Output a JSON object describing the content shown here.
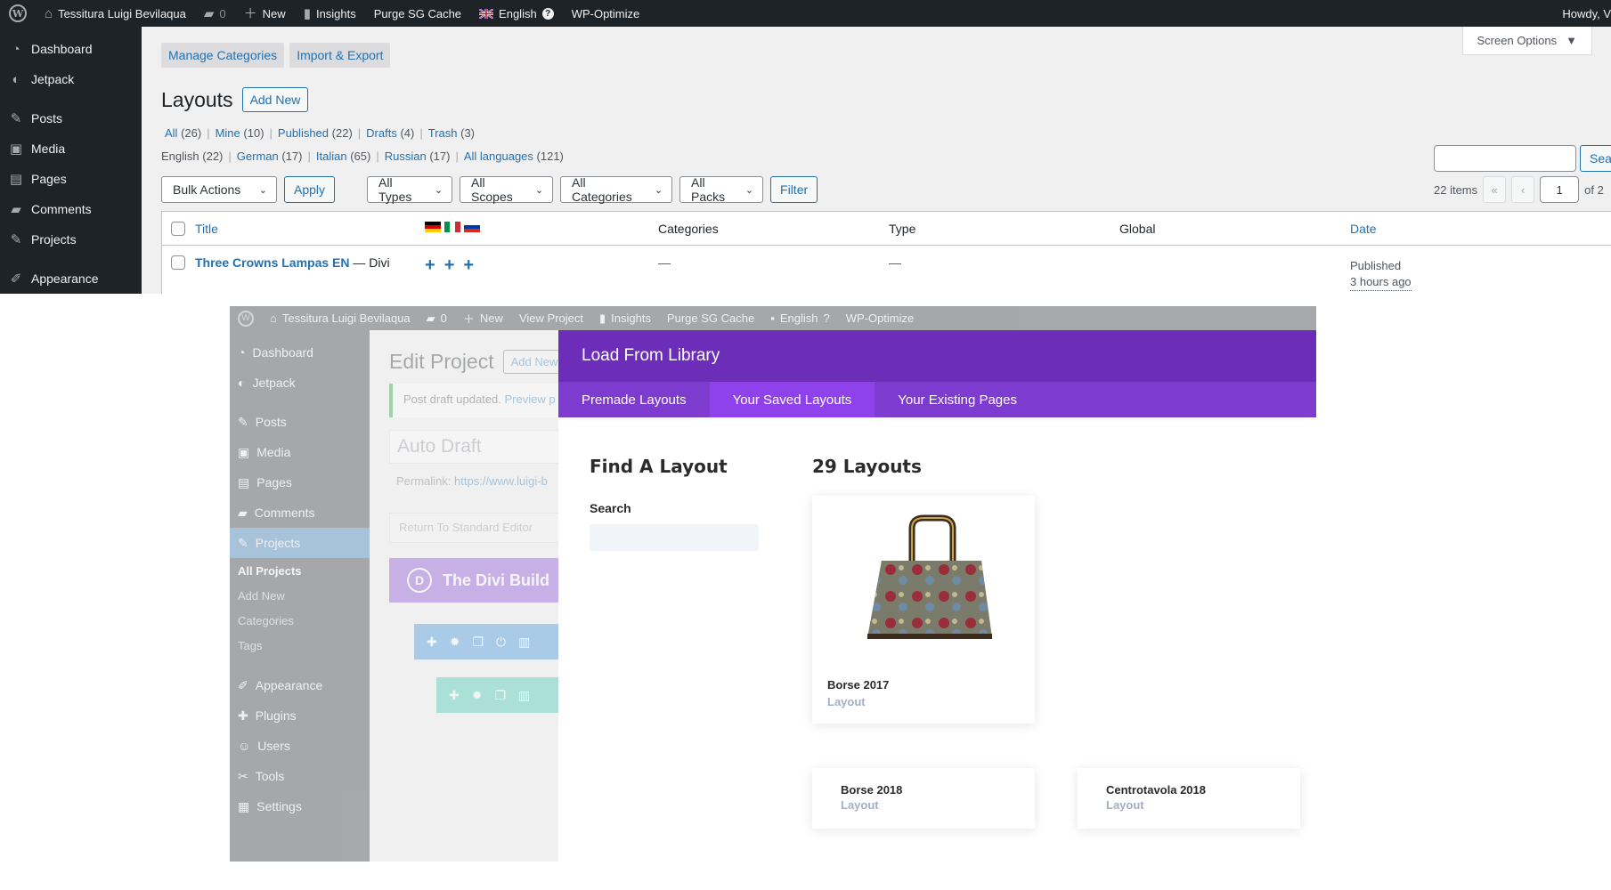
{
  "top": {
    "adminbar": {
      "site_name": "Tessitura Luigi Bevilaqua",
      "comments_count": "0",
      "new_label": "New",
      "insights_label": "Insights",
      "purge_label": "Purge SG Cache",
      "language_label": "English",
      "optimize_label": "WP-Optimize",
      "howdy_label": "Howdy, V"
    },
    "sidebar": [
      "Dashboard",
      "Jetpack",
      "Posts",
      "Media",
      "Pages",
      "Comments",
      "Projects",
      "Appearance"
    ],
    "subtabs": [
      "Manage Categories",
      "Import & Export"
    ],
    "screen_options": "Screen Options",
    "page_title": "Layouts",
    "add_new_label": "Add New",
    "views": [
      {
        "label": "All",
        "count": "(26)"
      },
      {
        "label": "Mine",
        "count": "(10)"
      },
      {
        "label": "Published",
        "count": "(22)"
      },
      {
        "label": "Drafts",
        "count": "(4)"
      },
      {
        "label": "Trash",
        "count": "(3)"
      }
    ],
    "languages": [
      {
        "label": "English",
        "count": "(22)"
      },
      {
        "label": "German",
        "count": "(17)"
      },
      {
        "label": "Italian",
        "count": "(65)"
      },
      {
        "label": "Russian",
        "count": "(17)"
      },
      {
        "label": "All languages",
        "count": "(121)"
      }
    ],
    "filters": {
      "bulk_actions": "Bulk Actions",
      "apply": "Apply",
      "types": "All Types",
      "scopes": "All Scopes",
      "categories": "All Categories",
      "packs": "All Packs",
      "filter": "Filter"
    },
    "search_button": "Sear",
    "pagination": {
      "items": "22 items",
      "first": "«",
      "prev": "‹",
      "current": "1",
      "of": "of 2"
    },
    "table": {
      "headers": {
        "title": "Title",
        "categories": "Categories",
        "type": "Type",
        "global": "Global",
        "date": "Date"
      },
      "row": {
        "title": "Three Crowns Lampas EN",
        "suffix": "— Divi",
        "categories": "—",
        "type": "—",
        "date_status": "Published",
        "date_ago": "3 hours ago"
      }
    }
  },
  "bottom": {
    "adminbar": {
      "site_name": "Tessitura Luigi Bevilaqua",
      "comments_count": "0",
      "new_label": "New",
      "view_project": "View Project",
      "insights_label": "Insights",
      "purge_label": "Purge SG Cache",
      "language_label": "English",
      "optimize_label": "WP-Optimize"
    },
    "sidebar": {
      "items_top": [
        "Dashboard",
        "Jetpack",
        "Posts",
        "Media",
        "Pages",
        "Comments",
        "Projects"
      ],
      "submenu": [
        "All Projects",
        "Add New",
        "Categories",
        "Tags"
      ],
      "items_bottom": [
        "Appearance",
        "Plugins",
        "Users",
        "Tools",
        "Settings"
      ]
    },
    "editor": {
      "title": "Edit Project",
      "add_new": "Add New",
      "notice": "Post draft updated.",
      "notice_link": "Preview p",
      "title_placeholder": "Auto Draft",
      "permalink_label": "Permalink:",
      "permalink_url": "https://www.luigi-b",
      "return_button": "Return To Standard Editor",
      "divi_builder": "The Divi Build",
      "divi_letter": "D"
    },
    "modal": {
      "title": "Load From Library",
      "tabs": [
        "Premade Layouts",
        "Your Saved Layouts",
        "Your Existing Pages"
      ],
      "active_tab": 1,
      "find_title": "Find A Layout",
      "search_label": "Search",
      "count_title": "29 Layouts",
      "cards": [
        {
          "name": "Borse 2017",
          "type": "Layout"
        },
        {
          "name": "Borse 2018",
          "type": "Layout"
        },
        {
          "name": "Centrotavola 2018",
          "type": "Layout"
        }
      ]
    }
  },
  "colors": {
    "wp_dark": "#1d2327",
    "wp_blue": "#2271b1",
    "divi_purple_dark": "#6c2eb9",
    "divi_purple": "#7e3bd0",
    "divi_purple_active": "#8f42ec"
  }
}
